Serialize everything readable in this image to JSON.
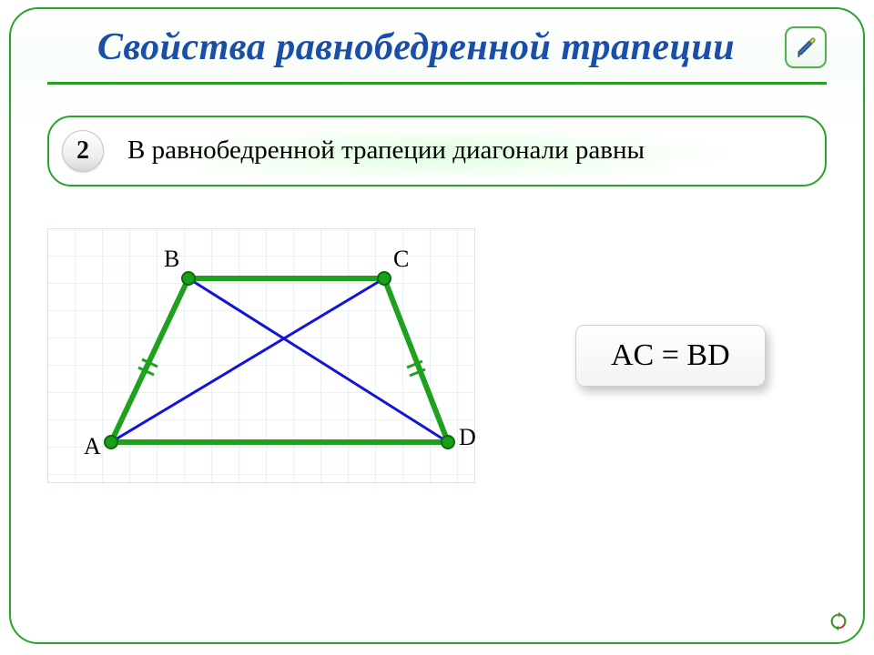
{
  "title": "Свойства равнобедренной трапеции",
  "property": {
    "number": "2",
    "text": "В равнобедренной трапеции диагонали равны"
  },
  "diagram": {
    "vertices": {
      "A": "A",
      "B": "B",
      "C": "C",
      "D": "D"
    }
  },
  "formula": "AC = BD",
  "colors": {
    "frame_green": "#28a428",
    "title_blue": "#1a4fa8",
    "edge_green": "#1fa01f",
    "diagonal_blue": "#1414d8",
    "vertex_fill": "#18a018"
  },
  "icons": {
    "pen": "pen-icon",
    "refresh": "refresh-icon"
  }
}
